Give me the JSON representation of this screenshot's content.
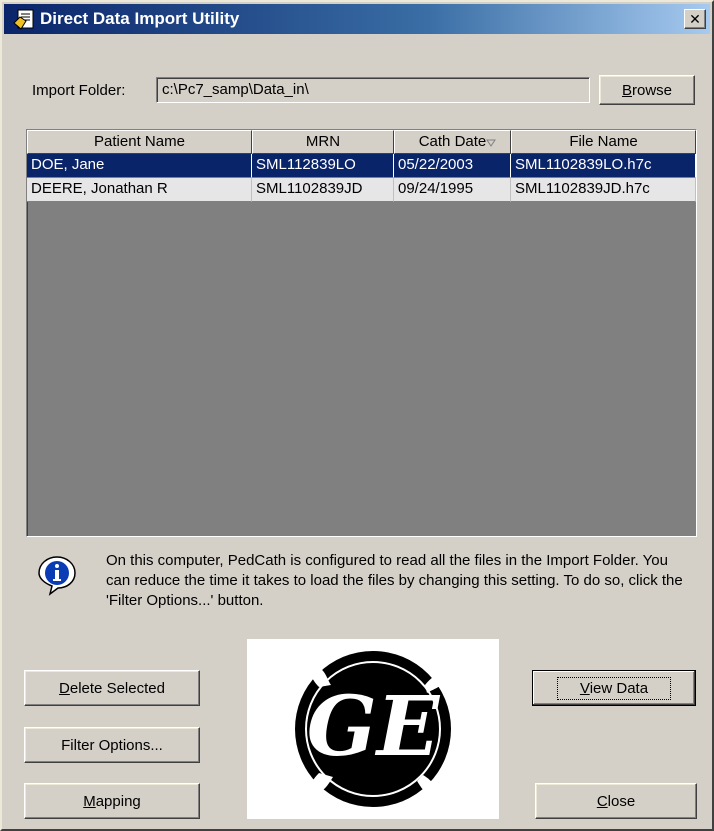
{
  "window": {
    "title": "Direct Data Import Utility",
    "close_glyph": "✕"
  },
  "import_folder": {
    "label": "Import Folder:",
    "value": "c:\\Pc7_samp\\Data_in\\"
  },
  "buttons": {
    "browse_pre": "",
    "browse_u": "B",
    "browse_post": "rowse",
    "delete_pre": "",
    "delete_u": "D",
    "delete_post": "elete Selected",
    "filter": "Filter Options...",
    "mapping_pre": "",
    "mapping_u": "M",
    "mapping_post": "apping",
    "view_pre": "",
    "view_u": "V",
    "view_post": "iew Data",
    "close_pre": "",
    "close_u": "C",
    "close_post": "lose"
  },
  "table": {
    "columns": [
      "Patient Name",
      "MRN",
      "Cath Date",
      "File Name"
    ],
    "rows": [
      {
        "name": "DOE, Jane",
        "mrn": "SML112839LO",
        "cath_date": "05/22/2003",
        "file": "SML1102839LO.h7c",
        "selected": true
      },
      {
        "name": "DEERE, Jonathan R",
        "mrn": "SML1102839JD",
        "cath_date": "09/24/1995",
        "file": "SML1102839JD.h7c",
        "selected": false
      }
    ]
  },
  "info": {
    "icon": "info-icon",
    "text": "On this computer, PedCath is configured to read all the files in the Import Folder. You can reduce the time it takes to load the files by changing this setting. To do so, click the 'Filter Options...' button."
  },
  "logo": {
    "icon": "ge-logo",
    "text": "GE"
  },
  "colors": {
    "selection": "#0a246a",
    "face": "#d4d0c8",
    "grid_empty": "#808080"
  }
}
